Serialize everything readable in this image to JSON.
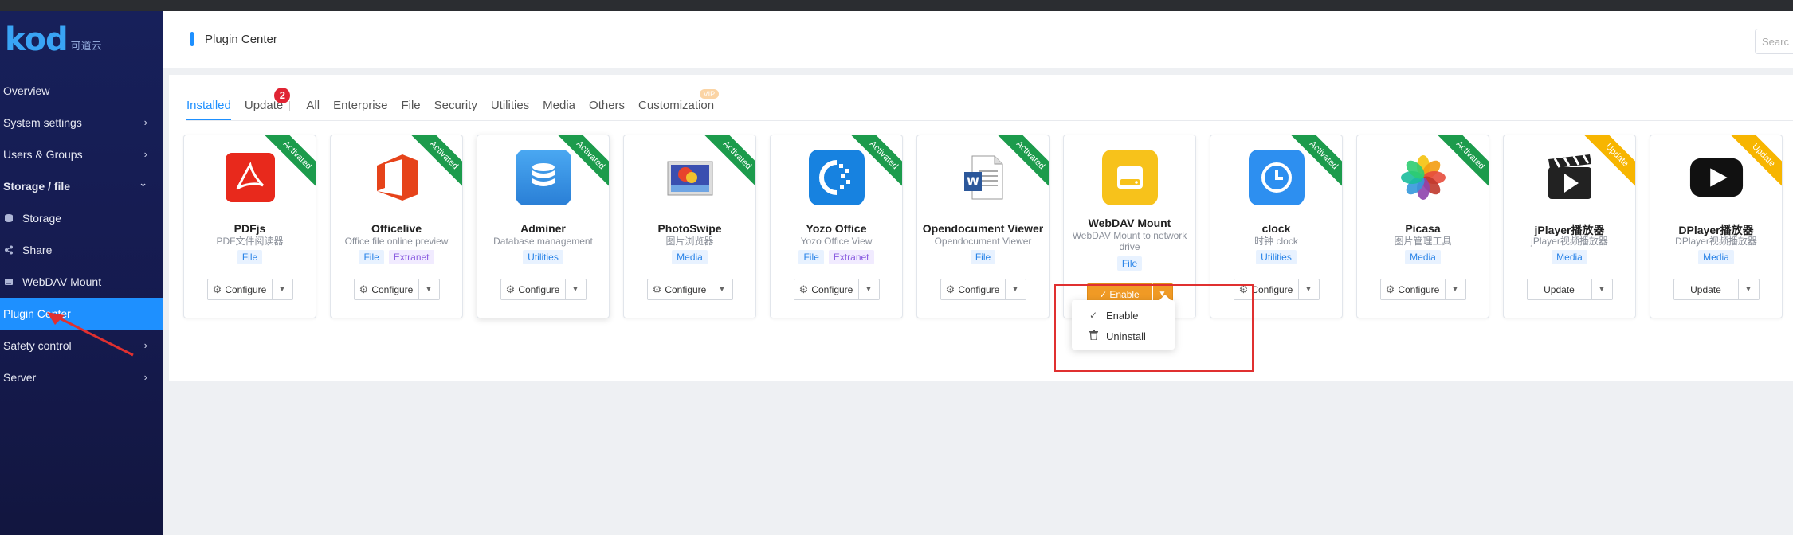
{
  "sidebar": {
    "logo": "kod",
    "logo_sub": "可道云",
    "items": [
      {
        "label": "Overview",
        "chevron": ""
      },
      {
        "label": "System settings",
        "chevron": "›"
      },
      {
        "label": "Users & Groups",
        "chevron": "›"
      },
      {
        "label": "Storage / file",
        "chevron": "⌄"
      },
      {
        "label": "Storage",
        "chevron": ""
      },
      {
        "label": "Share",
        "chevron": ""
      },
      {
        "label": "WebDAV Mount",
        "chevron": ""
      },
      {
        "label": "Plugin Center",
        "chevron": ""
      },
      {
        "label": "Safety control",
        "chevron": "›"
      },
      {
        "label": "Server",
        "chevron": "›"
      }
    ]
  },
  "header": {
    "title": "Plugin Center",
    "search_placeholder": "Searc"
  },
  "tabs": [
    {
      "label": "Installed"
    },
    {
      "label": "Update",
      "badge": "2"
    },
    {
      "label": "All"
    },
    {
      "label": "Enterprise"
    },
    {
      "label": "File"
    },
    {
      "label": "Security"
    },
    {
      "label": "Utilities"
    },
    {
      "label": "Media"
    },
    {
      "label": "Others"
    },
    {
      "label": "Customization",
      "vip": "VIP"
    }
  ],
  "ribbons": {
    "activated": "Activated",
    "update": "Update"
  },
  "buttons": {
    "configure": "Configure",
    "update": "Update",
    "enable": "Enable"
  },
  "plugins": [
    {
      "name": "PDFjs",
      "desc": "PDF文件阅读器",
      "tags": [
        "File"
      ]
    },
    {
      "name": "Officelive",
      "desc": "Office file online preview",
      "tags": [
        "File",
        "Extranet"
      ]
    },
    {
      "name": "Adminer",
      "desc": "Database management",
      "tags": [
        "Utilities"
      ]
    },
    {
      "name": "PhotoSwipe",
      "desc": "图片浏览器",
      "tags": [
        "Media"
      ]
    },
    {
      "name": "Yozo Office",
      "desc": "Yozo Office View",
      "tags": [
        "File",
        "Extranet"
      ]
    },
    {
      "name": "Opendocument Viewer",
      "desc": "Opendocument Viewer",
      "tags": [
        "File"
      ]
    },
    {
      "name": "WebDAV Mount",
      "desc": "WebDAV Mount to network drive",
      "tags": [
        "File"
      ]
    },
    {
      "name": "clock",
      "desc": "时钟 clock",
      "tags": [
        "Utilities"
      ]
    },
    {
      "name": "Picasa",
      "desc": "图片管理工具",
      "tags": [
        "Media"
      ]
    },
    {
      "name": "jPlayer播放器",
      "desc": "jPlayer视频播放器",
      "tags": [
        "Media"
      ]
    },
    {
      "name": "DPlayer播放器",
      "desc": "DPlayer视频播放器",
      "tags": [
        "Media"
      ]
    }
  ],
  "dropdown": {
    "items": [
      "Enable",
      "Uninstall"
    ]
  },
  "colors": {
    "accent": "#1e90ff",
    "sidebar": "#17205a",
    "activated": "#1c9b4c",
    "update": "#f7b500",
    "enable": "#f09a25",
    "annotation": "#e03030"
  }
}
